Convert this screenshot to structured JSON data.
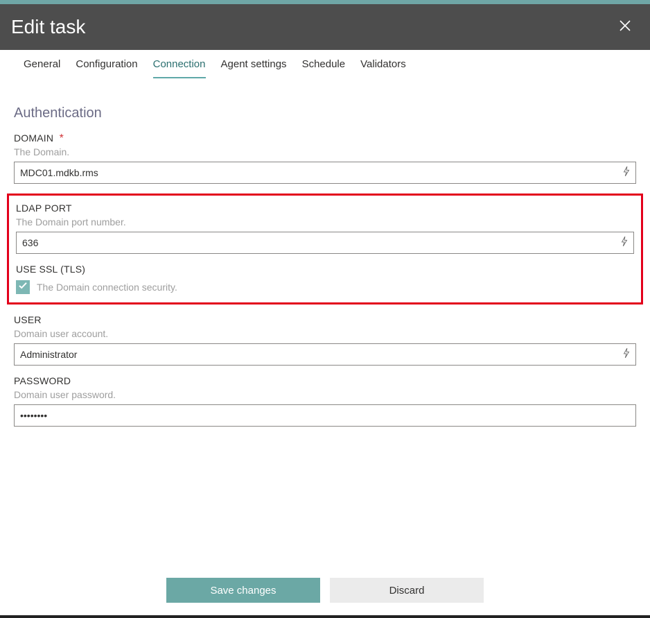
{
  "header": {
    "title": "Edit task"
  },
  "tabs": [
    {
      "label": "General"
    },
    {
      "label": "Configuration"
    },
    {
      "label": "Connection"
    },
    {
      "label": "Agent settings"
    },
    {
      "label": "Schedule"
    },
    {
      "label": "Validators"
    }
  ],
  "activeTabIndex": 2,
  "sectionTitle": "Authentication",
  "fields": {
    "domain": {
      "label": "DOMAIN",
      "required": "*",
      "desc": "The Domain.",
      "value": "MDC01.mdkb.rms"
    },
    "port": {
      "label": "LDAP PORT",
      "desc": "The Domain port number.",
      "value": "636"
    },
    "ssl": {
      "label": "USE SSL (TLS)",
      "desc": "The Domain connection security.",
      "checked": true
    },
    "user": {
      "label": "USER",
      "desc": "Domain user account.",
      "value": "Administrator"
    },
    "password": {
      "label": "PASSWORD",
      "desc": "Domain user password.",
      "value": "••••••••"
    }
  },
  "buttons": {
    "save": "Save changes",
    "discard": "Discard"
  }
}
